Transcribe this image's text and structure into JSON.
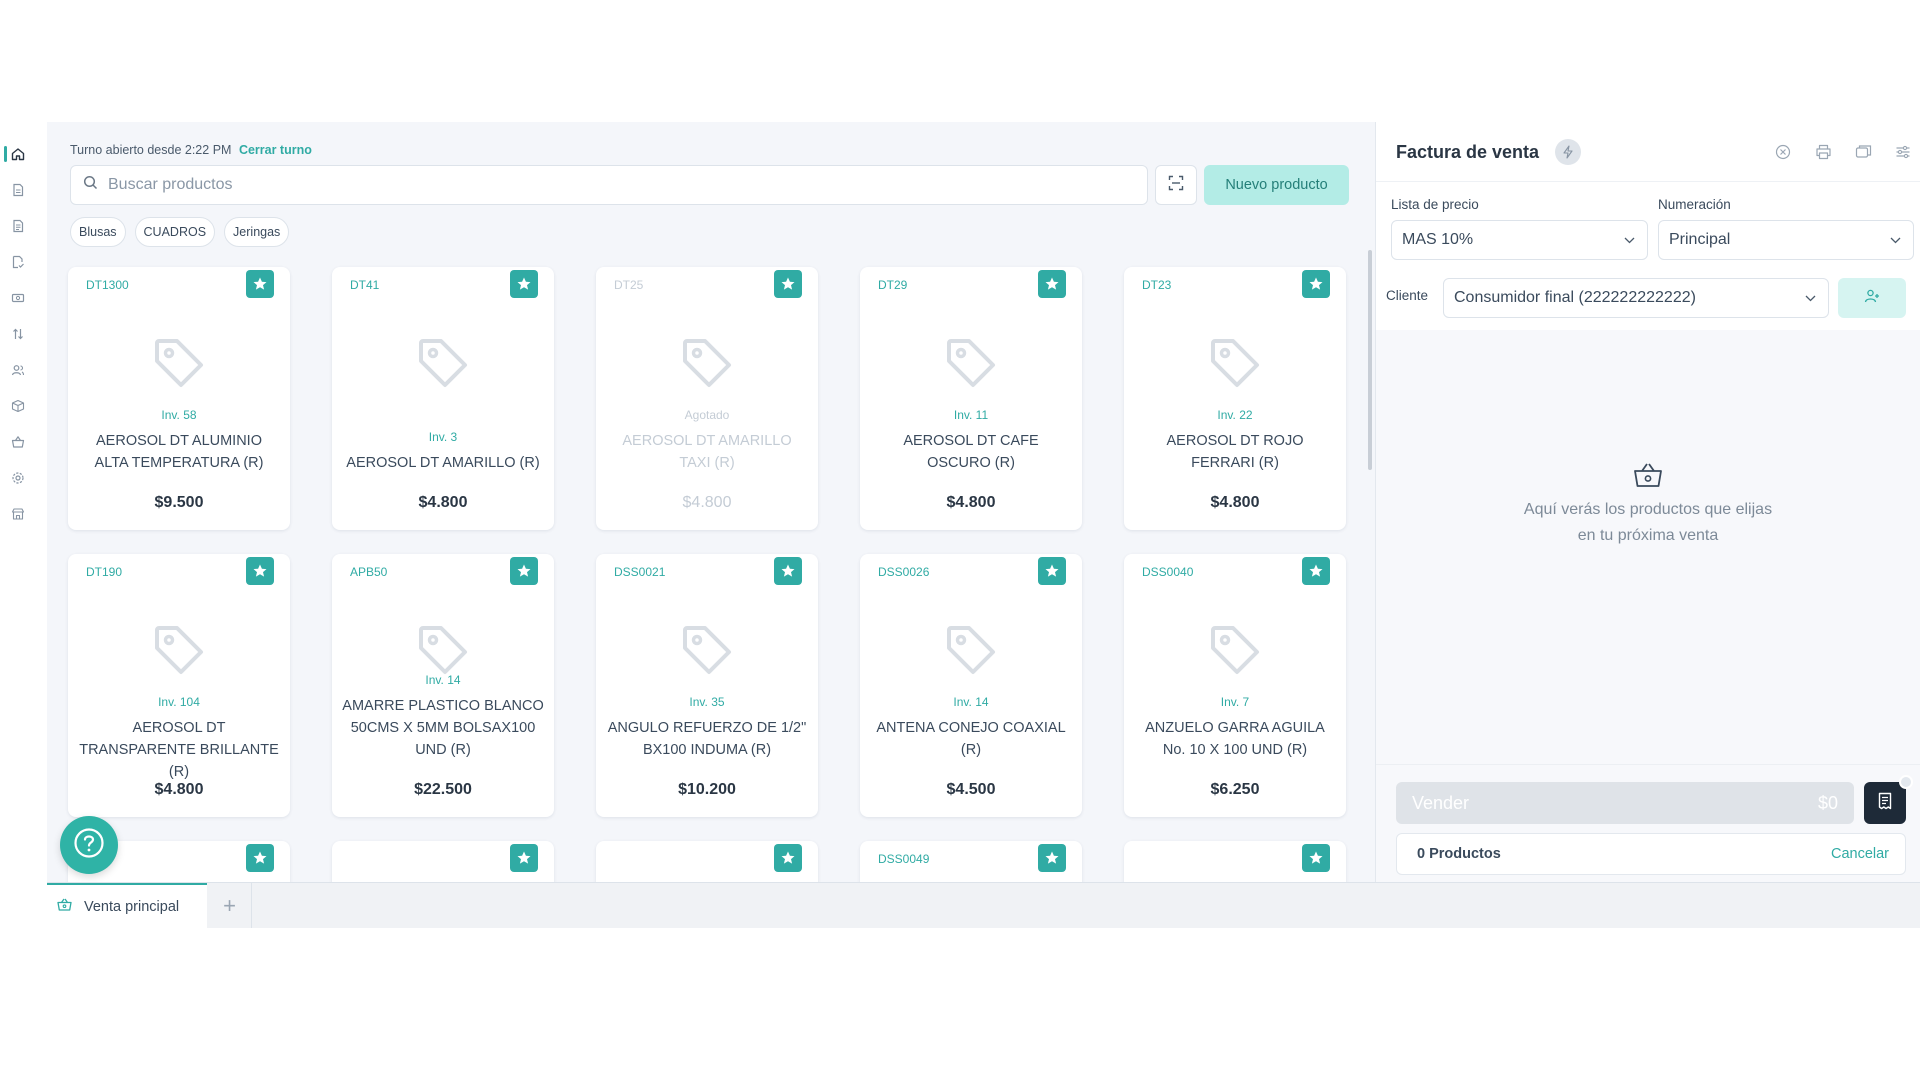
{
  "sidebar": {
    "items": [
      {
        "icon": "home-icon"
      },
      {
        "icon": "document-icon"
      },
      {
        "icon": "document-list-icon"
      },
      {
        "icon": "document-check-icon"
      },
      {
        "icon": "cash-icon"
      },
      {
        "icon": "transfer-icon"
      },
      {
        "icon": "contacts-icon"
      },
      {
        "icon": "box-icon"
      },
      {
        "icon": "basket-icon"
      },
      {
        "icon": "settings-icon"
      },
      {
        "icon": "store-icon"
      }
    ]
  },
  "main": {
    "shift_text": "Turno abierto desde 2:22 PM",
    "close_shift_label": "Cerrar turno",
    "search_placeholder": "Buscar productos",
    "new_product_label": "Nuevo producto",
    "categories": [
      "Blusas",
      "CUADROS",
      "Jeringas"
    ]
  },
  "products": [
    {
      "code": "DT1300",
      "inv": "Inv. 58",
      "name": "AEROSOL DT ALUMINIO ALTA TEMPERATURA (R)",
      "price": "$9.500",
      "disabled": false
    },
    {
      "code": "DT41",
      "inv": "Inv. 3",
      "name": "AEROSOL DT AMARILLO (R)",
      "price": "$4.800",
      "disabled": false
    },
    {
      "code": "DT25",
      "inv": "Agotado",
      "name": "AEROSOL DT AMARILLO TAXI (R)",
      "price": "$4.800",
      "disabled": true
    },
    {
      "code": "DT29",
      "inv": "Inv. 11",
      "name": "AEROSOL DT CAFE OSCURO (R)",
      "price": "$4.800",
      "disabled": false
    },
    {
      "code": "DT23",
      "inv": "Inv. 22",
      "name": "AEROSOL DT ROJO FERRARI (R)",
      "price": "$4.800",
      "disabled": false
    },
    {
      "code": "DT190",
      "inv": "Inv. 104",
      "name": "AEROSOL DT TRANSPARENTE BRILLANTE (R)",
      "price": "$4.800",
      "disabled": false
    },
    {
      "code": "APB50",
      "inv": "Inv. 14",
      "name": "AMARRE PLASTICO BLANCO 50CMS X 5MM BOLSAX100 UND (R)",
      "price": "$22.500",
      "disabled": false
    },
    {
      "code": "DSS0021",
      "inv": "Inv. 35",
      "name": "ANGULO REFUERZO DE 1/2\" BX100 INDUMA (R)",
      "price": "$10.200",
      "disabled": false
    },
    {
      "code": "DSS0026",
      "inv": "Inv. 14",
      "name": "ANTENA CONEJO COAXIAL (R)",
      "price": "$4.500",
      "disabled": false
    },
    {
      "code": "DSS0040",
      "inv": "Inv. 7",
      "name": "ANZUELO GARRA AGUILA No. 10 X 100 UND (R)",
      "price": "$6.250",
      "disabled": false
    },
    {
      "code": "",
      "inv": "",
      "name": "",
      "price": "",
      "disabled": false
    },
    {
      "code": "",
      "inv": "",
      "name": "",
      "price": "",
      "disabled": false
    },
    {
      "code": "",
      "inv": "",
      "name": "",
      "price": "",
      "disabled": false
    },
    {
      "code": "DSS0049",
      "inv": "",
      "name": "",
      "price": "",
      "disabled": false
    },
    {
      "code": "",
      "inv": "",
      "name": "",
      "price": "",
      "disabled": false
    }
  ],
  "tabs": {
    "active_label": "Venta principal",
    "add_label": "+"
  },
  "invoice": {
    "title": "Factura de venta",
    "price_list_label": "Lista de precio",
    "price_list_value": "MAS 10%",
    "numbering_label": "Numeración",
    "numbering_value": "Principal",
    "client_label": "Cliente",
    "client_value": "Consumidor final (222222222222)",
    "empty_line1": "Aquí verás los productos que elijas",
    "empty_line2": "en tu próxima venta",
    "sell_label": "Vender",
    "sell_total": "$0",
    "products_count": "0 Productos",
    "cancel_label": "Cancelar"
  },
  "colors": {
    "accent": "#30aba4",
    "new_button_bg": "#b3ece6",
    "dark_button": "#1e2a38"
  }
}
